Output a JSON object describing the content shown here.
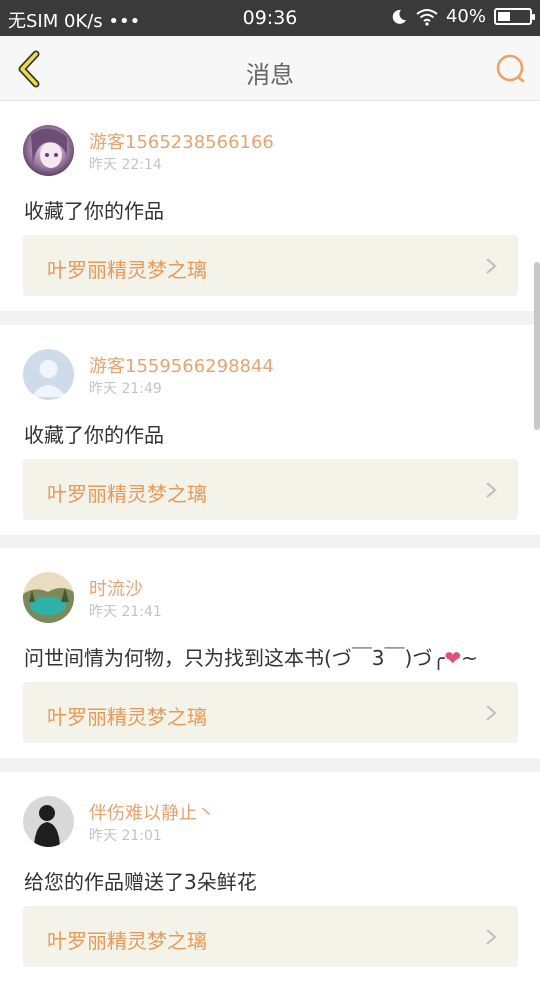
{
  "status_bar": {
    "carrier": "无SIM 0K/s •••",
    "time": "09:36",
    "battery_text": "40%",
    "battery_level": 0.4
  },
  "nav": {
    "title": "消息"
  },
  "messages": [
    {
      "username": "游客1565238566166",
      "time": "昨天 22:14",
      "text": "收藏了你的作品",
      "work_title": "叶罗丽精灵梦之璃",
      "avatar": "anime-girl-avatar"
    },
    {
      "username": "游客1559566298844",
      "time": "昨天 21:49",
      "text": "收藏了你的作品",
      "work_title": "叶罗丽精灵梦之璃",
      "avatar": "default-user-avatar"
    },
    {
      "username": "时流沙",
      "time": "昨天 21:41",
      "text": "问世间情为何物，只为找到这本书(づ￣3￣)づ╭",
      "text_suffix": "~",
      "work_title": "叶罗丽精灵梦之璃",
      "avatar": "landscape-avatar"
    },
    {
      "username": "伴伤难以静止丶",
      "time": "昨天 21:01",
      "text": "给您的作品赠送了3朵鲜花",
      "work_title": "叶罗丽精灵梦之璃",
      "avatar": "silhouette-avatar"
    }
  ],
  "colors": {
    "accent": "#e8a470",
    "work_title": "#e89a58",
    "work_bg": "#f3f3ea",
    "status_bg": "#3a3a3a"
  }
}
